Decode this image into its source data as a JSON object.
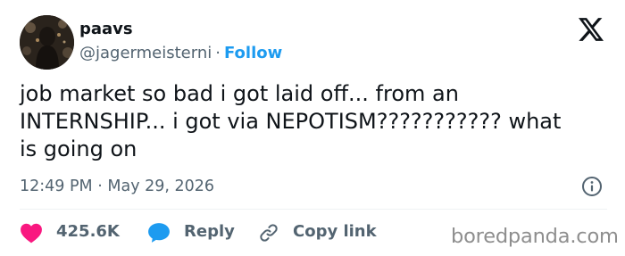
{
  "author": {
    "display_name": "paavs",
    "handle": "@jagermeisterni",
    "separator": "·",
    "follow_label": "Follow"
  },
  "tweet": {
    "lines": [
      "job market so bad i got laid off... from an",
      "INTERNSHIP... i got via NEPOTISM??????????? what",
      "is going on"
    ],
    "time": "12:49 PM",
    "separator": "·",
    "date": "May 29, 2026"
  },
  "actions": {
    "like_count": "425.6K",
    "reply_label": "Reply",
    "copy_label": "Copy link"
  },
  "watermark": "boredpanda.com",
  "colors": {
    "accent": "#1d9bf0",
    "like": "#f91880",
    "text": "#0f1419",
    "secondary": "#536471",
    "watermark": "#8e8e8e"
  },
  "icons": {
    "platform": "x-logo-icon",
    "info": "info-icon",
    "like": "heart-icon",
    "reply": "speech-bubble-icon",
    "copy": "link-icon"
  }
}
